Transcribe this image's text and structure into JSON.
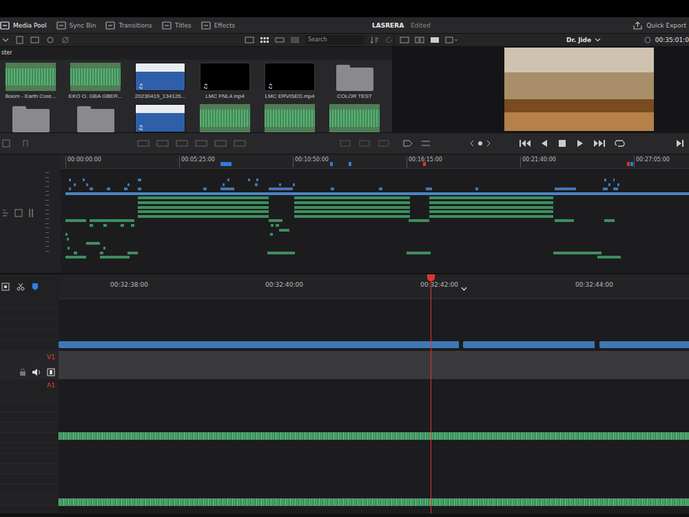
{
  "window": {
    "title": "LASRERA",
    "status": "Edited"
  },
  "toolbar": {
    "tabs": [
      {
        "label": "Media Pool",
        "selected": true
      },
      {
        "label": "Sync Bin",
        "selected": false
      },
      {
        "label": "Transitions",
        "selected": false
      },
      {
        "label": "Titles",
        "selected": false
      },
      {
        "label": "Effects",
        "selected": false
      }
    ],
    "quick_export": "Quick Export"
  },
  "media_pool": {
    "bin": "ster",
    "search": {
      "placeholder": "Search"
    },
    "items": [
      {
        "label": "Boom - Earth Core...",
        "kind": "audio"
      },
      {
        "label": "EKO O. GBA GBER...",
        "kind": "audio"
      },
      {
        "label": "20230419_134126...",
        "kind": "image",
        "icon": "♫"
      },
      {
        "label": "LMC FNL4.mp4",
        "kind": "video",
        "icon": "♫"
      },
      {
        "label": "LMC ERVISED.mp4",
        "kind": "video",
        "icon": "♫"
      },
      {
        "label": "COLOR TEST",
        "kind": "folder"
      },
      {
        "kind": "folder"
      },
      {
        "kind": "folder"
      },
      {
        "kind": "image",
        "icon": "♫"
      },
      {
        "kind": "audio"
      },
      {
        "kind": "audio"
      },
      {
        "kind": "audio"
      }
    ]
  },
  "viewer": {
    "clip": "Dr. Jide",
    "timecode": "00:35:01:0"
  },
  "overview": {
    "ruler": [
      {
        "label": "00:00:00:00",
        "time": 0
      },
      {
        "label": "00:05:25:00",
        "time": 325
      },
      {
        "label": "00:10:50:00",
        "time": 650
      },
      {
        "label": "00:16:15:00",
        "time": 975
      },
      {
        "label": "00:21:40:00",
        "time": 1300
      },
      {
        "label": "00:27:05:00",
        "time": 1625
      }
    ],
    "markers": [
      {
        "time": 443,
        "color": "#2f7fe0"
      },
      {
        "time": 451,
        "color": "#2f7fe0"
      },
      {
        "time": 459,
        "color": "#2f7fe0"
      },
      {
        "time": 467,
        "color": "#2f7fe0"
      },
      {
        "time": 756,
        "color": "#2f7fe0"
      },
      {
        "time": 810,
        "color": "#2f7fe0"
      },
      {
        "time": 1022,
        "color": "#e0342c"
      },
      {
        "time": 1605,
        "color": "#e0342c"
      },
      {
        "time": 1615,
        "color": "#2f7fe0"
      }
    ],
    "tracks": [
      {
        "color": "#3f78b5",
        "segments": [
          [
            10,
            16
          ],
          [
            49,
            55
          ],
          [
            207,
            217
          ],
          [
            463,
            469
          ],
          [
            522,
            528
          ],
          [
            546,
            552
          ],
          [
            1541,
            1546
          ],
          [
            1566,
            1570
          ]
        ]
      },
      {
        "color": "#3f78b5",
        "segments": [
          [
            24,
            30
          ],
          [
            59,
            65
          ],
          [
            177,
            183
          ],
          [
            449,
            455
          ],
          [
            542,
            550
          ],
          [
            611,
            617
          ],
          [
            650,
            656
          ],
          [
            1552,
            1558
          ],
          [
            1577,
            1583
          ]
        ]
      },
      {
        "color": "#3f78b5",
        "segments": [
          [
            10,
            16
          ],
          [
            69,
            79
          ],
          [
            118,
            128
          ],
          [
            167,
            177
          ],
          [
            207,
            217
          ],
          [
            394,
            404
          ],
          [
            443,
            483
          ],
          [
            581,
            650
          ],
          [
            758,
            768
          ],
          [
            896,
            906
          ],
          [
            1030,
            1048
          ],
          [
            1172,
            1180
          ],
          [
            1399,
            1460
          ],
          [
            1537,
            1550
          ],
          [
            1566,
            1580
          ]
        ]
      },
      {
        "color": "#4a86c2",
        "segments": [
          [
            0,
            1783
          ]
        ]
      },
      {
        "color": "#3d8f5d",
        "segments": [
          [
            207,
            581
          ],
          [
            654,
            985
          ],
          [
            1040,
            1395
          ]
        ]
      },
      {
        "color": "#3d8f5d",
        "segments": [
          [
            207,
            581
          ],
          [
            654,
            985
          ],
          [
            1040,
            1395
          ]
        ]
      },
      {
        "color": "#3d8f5d",
        "segments": [
          [
            207,
            581
          ],
          [
            654,
            985
          ],
          [
            1040,
            1395
          ]
        ]
      },
      {
        "color": "#3d8f5d",
        "segments": [
          [
            207,
            581
          ],
          [
            654,
            985
          ],
          [
            1040,
            1395
          ]
        ]
      },
      {
        "color": "#3d8f5d",
        "segments": [
          [
            207,
            581
          ],
          [
            654,
            985
          ],
          [
            1040,
            1395
          ]
        ]
      },
      {
        "color": "#3d8f5d",
        "segments": [
          [
            0,
            59
          ],
          [
            69,
            197
          ],
          [
            581,
            620
          ],
          [
            981,
            1040
          ],
          [
            1399,
            1454
          ],
          [
            1541,
            1570
          ]
        ]
      },
      {
        "color": "#3d8f5d",
        "segments": [
          [
            69,
            79
          ],
          [
            108,
            118
          ],
          [
            158,
            167
          ],
          [
            187,
            197
          ],
          [
            587,
            595
          ],
          [
            601,
            611
          ]
        ]
      },
      {
        "color": "#3d8f5d",
        "segments": [
          [
            611,
            640
          ]
        ]
      },
      {
        "color": "#3d8f5d",
        "segments": [
          [
            0,
            6
          ],
          [
            585,
            593
          ]
        ]
      },
      {
        "color": "#3d8f5d",
        "segments": [
          [
            4,
            10
          ]
        ]
      },
      {
        "color": "#3d8f5d",
        "segments": [
          [
            59,
            98
          ]
        ]
      },
      {
        "color": "#3d8f5d",
        "segments": [
          [
            6,
            12
          ],
          [
            108,
            114
          ]
        ]
      },
      {
        "color": "#3d8f5d",
        "segments": [
          [
            24,
            34
          ],
          [
            98,
            108
          ],
          [
            177,
            207
          ],
          [
            577,
            656
          ],
          [
            975,
            1044
          ],
          [
            1395,
            1533
          ]
        ]
      },
      {
        "color": "#3d8f5d",
        "segments": [
          [
            0,
            59
          ],
          [
            98,
            183
          ],
          [
            1521,
            1587
          ]
        ]
      }
    ]
  },
  "timeline": {
    "ruler": [
      {
        "label": "00:32:38:00",
        "time": 0.667
      },
      {
        "label": "00:32:40:00",
        "time": 2.667
      },
      {
        "label": "00:32:42:00",
        "time": 4.667
      },
      {
        "label": "00:32:44:00",
        "time": 6.667
      }
    ],
    "playhead": 4.8,
    "video_clips": [
      [
        0,
        5.18
      ],
      [
        5.22,
        6.93
      ],
      [
        6.98,
        8.2
      ]
    ],
    "tracks": [
      {
        "label": "V1"
      },
      {
        "label": "A1"
      }
    ],
    "audio_clips": [
      [
        0,
        8.2
      ]
    ]
  }
}
